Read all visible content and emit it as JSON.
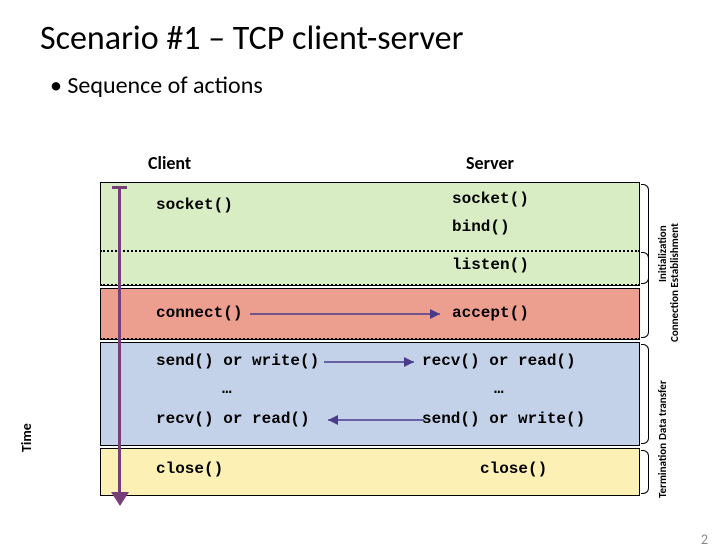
{
  "title": "Scenario #1 – TCP client-server",
  "bullet": "• Sequence of actions",
  "columns": {
    "client": "Client",
    "server": "Server"
  },
  "timeAxis": "Time",
  "phases": {
    "init": "Initialization",
    "conn": "Connection Establishment",
    "data": "Data transfer",
    "term": "Termination"
  },
  "client": {
    "socket": "socket()",
    "connect": "connect()",
    "send": "send() or write()",
    "recv": "recv() or read()",
    "close": "close()"
  },
  "server": {
    "socket": "socket()",
    "bind": "bind()",
    "listen": "listen()",
    "accept": "accept()",
    "recv": "recv() or read()",
    "send": "send() or write()",
    "close": "close()"
  },
  "ellipsis": "…",
  "pageNumber": "2"
}
